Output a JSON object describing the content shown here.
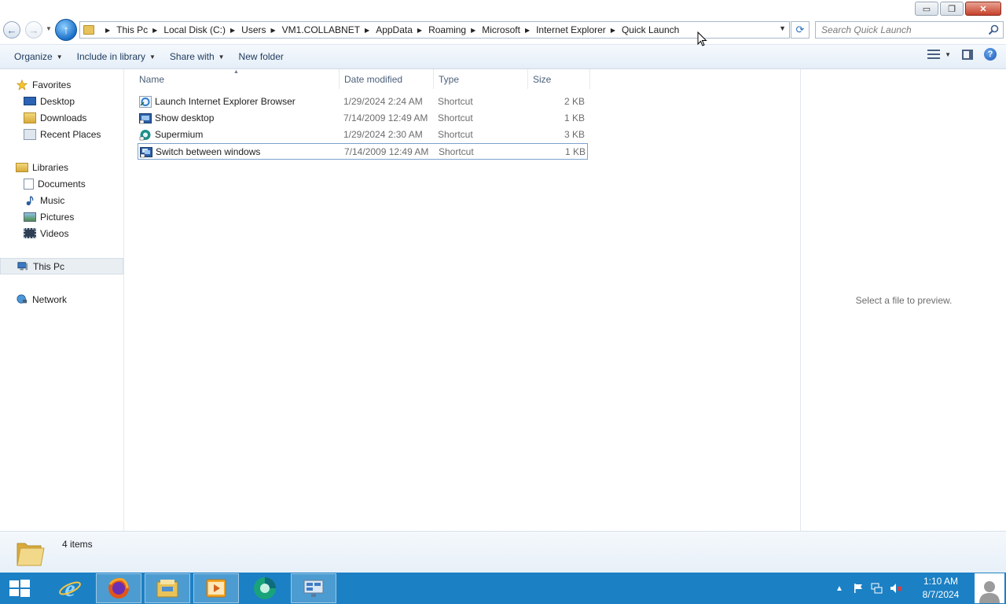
{
  "window": {
    "controls": {
      "minimize": "▭",
      "maximize": "❐",
      "close": "✕"
    }
  },
  "address": {
    "crumbs": [
      "This Pc",
      "Local Disk (C:)",
      "Users",
      "VM1.COLLABNET",
      "AppData",
      "Roaming",
      "Microsoft",
      "Internet Explorer",
      "Quick Launch"
    ]
  },
  "search": {
    "placeholder": "Search Quick Launch"
  },
  "toolbar": {
    "organize": "Organize",
    "include_in_library": "Include in library",
    "share_with": "Share with",
    "new_folder": "New folder"
  },
  "nav": {
    "favorites": "Favorites",
    "desktop": "Desktop",
    "downloads": "Downloads",
    "recent_places": "Recent Places",
    "libraries": "Libraries",
    "documents": "Documents",
    "music": "Music",
    "pictures": "Pictures",
    "videos": "Videos",
    "this_pc": "This Pc",
    "network": "Network"
  },
  "columns": {
    "name": "Name",
    "date": "Date modified",
    "type": "Type",
    "size": "Size"
  },
  "files": [
    {
      "name": "Launch Internet Explorer Browser",
      "date": "1/29/2024 2:24 AM",
      "type": "Shortcut",
      "size": "2 KB",
      "icon": "ie-shortcut-icon"
    },
    {
      "name": "Show desktop",
      "date": "7/14/2009 12:49 AM",
      "type": "Shortcut",
      "size": "1 KB",
      "icon": "desktop-shortcut-icon"
    },
    {
      "name": "Supermium",
      "date": "1/29/2024 2:30 AM",
      "type": "Shortcut",
      "size": "3 KB",
      "icon": "supermium-shortcut-icon"
    },
    {
      "name": "Switch between windows",
      "date": "7/14/2009 12:49 AM",
      "type": "Shortcut",
      "size": "1 KB",
      "icon": "switch-windows-shortcut-icon",
      "selected": true
    }
  ],
  "preview": {
    "message": "Select a file to preview."
  },
  "details": {
    "count": "4 items"
  },
  "taskbar": {
    "time": "1:10 AM",
    "date": "8/7/2024",
    "apps": [
      "internet-explorer",
      "firefox",
      "file-explorer",
      "media-player",
      "supermium",
      "server-manager"
    ]
  },
  "colors": {
    "taskbar": "#1c80c4",
    "accent": "#2a6fc0",
    "selection_border": "#7da2ce"
  }
}
